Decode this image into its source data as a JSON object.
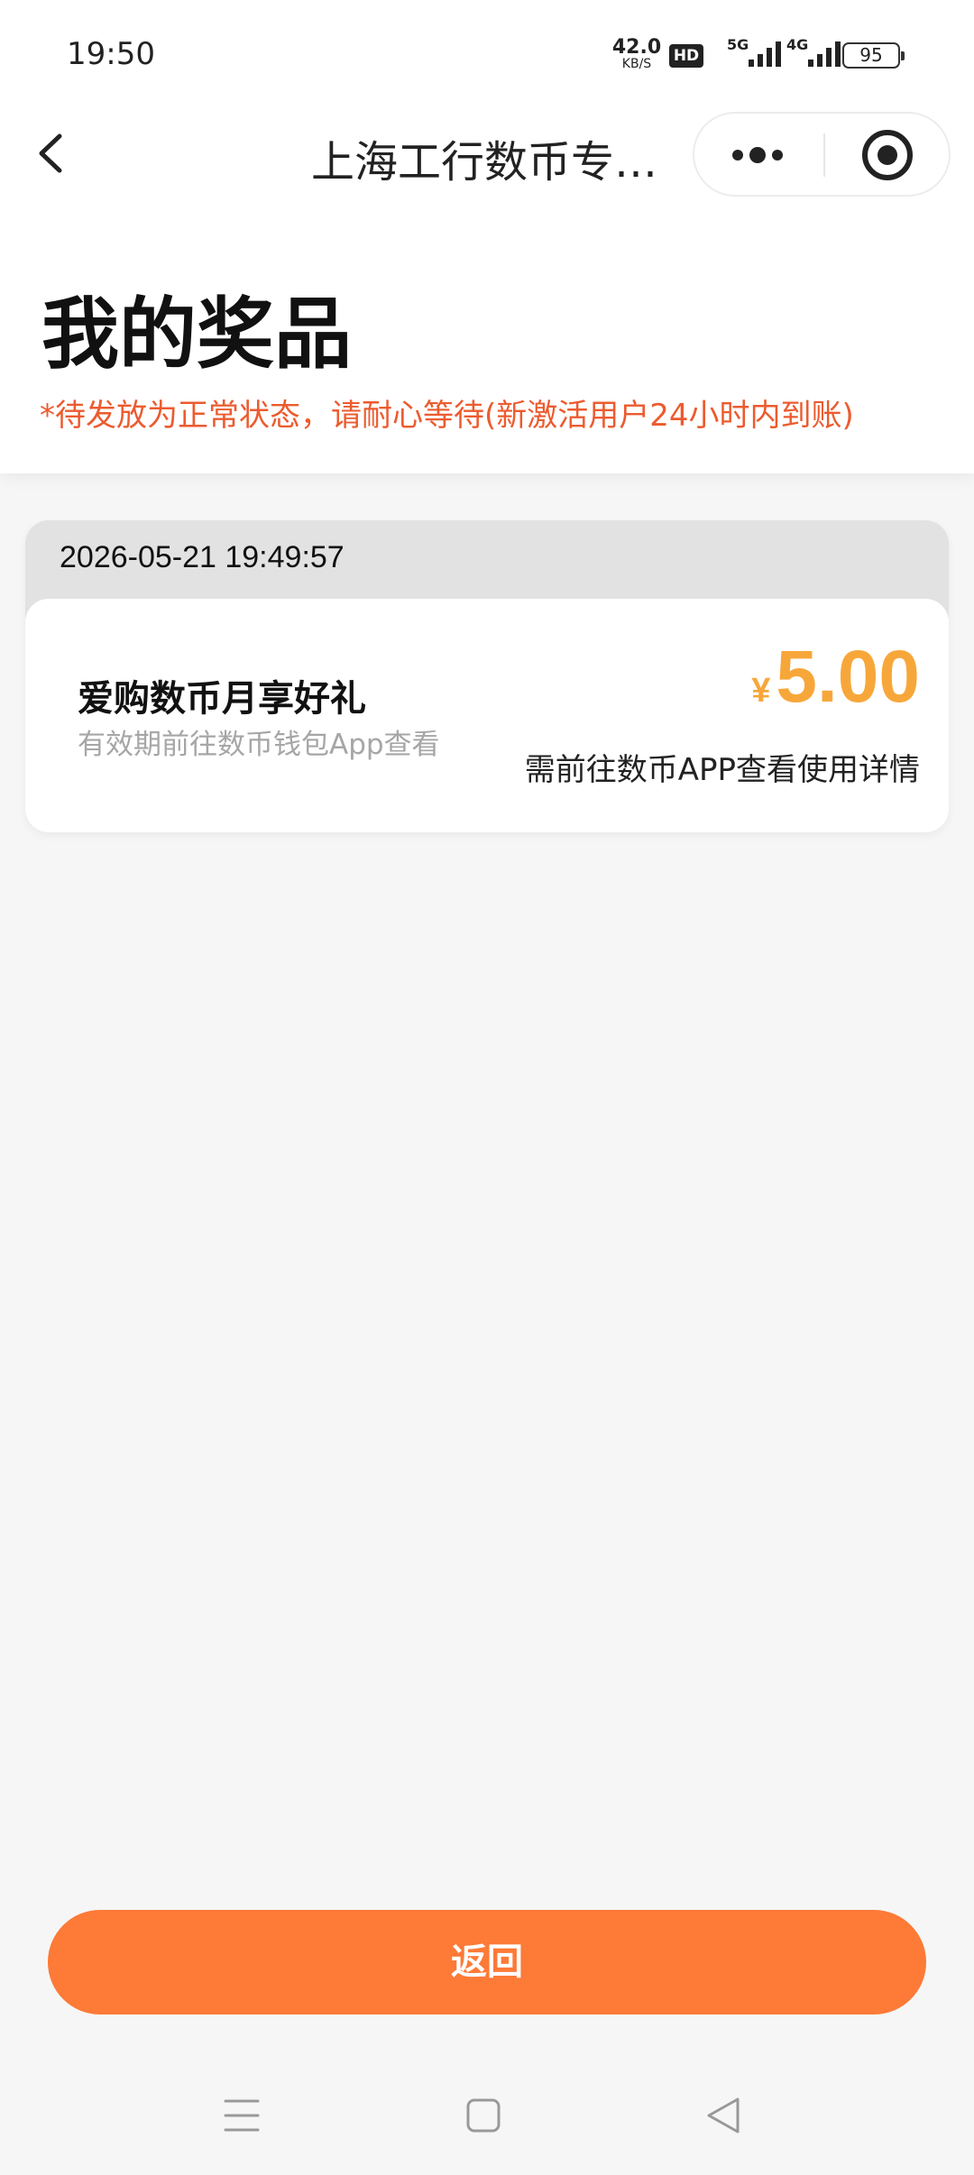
{
  "status_bar": {
    "time": "19:50",
    "net_speed": "42.0",
    "net_speed_unit": "KB/S",
    "hd_badge": "HD",
    "signal_1_label": "5G",
    "signal_2_label": "4G",
    "battery": "95"
  },
  "nav": {
    "title": "上海工行数币专…",
    "back_icon": "chevron-left-icon",
    "more_icon": "more-dots-icon",
    "target_icon": "target-icon"
  },
  "page": {
    "heading": "我的奖品",
    "notice": "*待发放为正常状态，请耐心等待(新激活用户24小时内到账)"
  },
  "prizes": [
    {
      "timestamp": "2026-05-21 19:49:57",
      "name": "爱购数币月享好礼",
      "validity": "有效期前往数币钱包App查看",
      "currency": "¥",
      "amount": "5.00",
      "hint": "需前往数币APP查看使用详情"
    }
  ],
  "footer": {
    "return_label": "返回"
  },
  "colors": {
    "accent": "#fd7a37",
    "notice": "#ec5b2f",
    "amount": "#f7a73a"
  }
}
